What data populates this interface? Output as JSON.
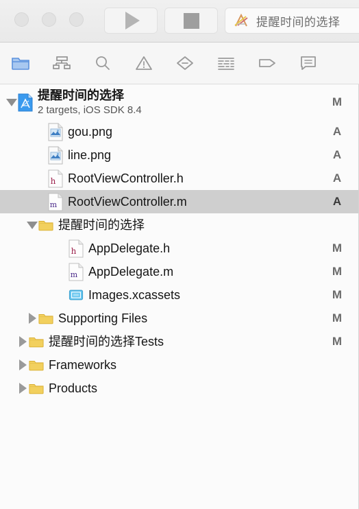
{
  "window": {
    "traffic_lights": [
      "close",
      "minimize",
      "zoom"
    ]
  },
  "toolbar": {
    "run_label": "Run",
    "stop_label": "Stop",
    "scheme_name": "提醒时间的选择"
  },
  "navigator_tabs": [
    {
      "name": "project-navigator",
      "icon": "folder-icon",
      "active": true
    },
    {
      "name": "symbol-navigator",
      "icon": "hierarchy-icon",
      "active": false
    },
    {
      "name": "find-navigator",
      "icon": "search-icon",
      "active": false
    },
    {
      "name": "issue-navigator",
      "icon": "warning-triangle-icon",
      "active": false
    },
    {
      "name": "test-navigator",
      "icon": "diamond-icon",
      "active": false
    },
    {
      "name": "debug-navigator",
      "icon": "debug-lines-icon",
      "active": false
    },
    {
      "name": "breakpoint-navigator",
      "icon": "breakpoint-tag-icon",
      "active": false
    },
    {
      "name": "report-navigator",
      "icon": "comment-bubble-icon",
      "active": false
    }
  ],
  "tree": {
    "rows": [
      {
        "label": "提醒时间的选择",
        "subtitle": "2 targets, iOS SDK 8.4",
        "badge": "M",
        "icon": "xcode-project-icon",
        "disclosure": "down",
        "indent": 0,
        "selected": false,
        "bold": true
      },
      {
        "label": "gou.png",
        "subtitle": "",
        "badge": "A",
        "icon": "png-image-icon",
        "disclosure": "none",
        "indent": 1,
        "selected": false,
        "bold": false
      },
      {
        "label": "line.png",
        "subtitle": "",
        "badge": "A",
        "icon": "png-image-icon",
        "disclosure": "none",
        "indent": 1,
        "selected": false,
        "bold": false
      },
      {
        "label": "RootViewController.h",
        "subtitle": "",
        "badge": "A",
        "icon": "header-file-icon",
        "disclosure": "none",
        "indent": 1,
        "selected": false,
        "bold": false
      },
      {
        "label": "RootViewController.m",
        "subtitle": "",
        "badge": "A",
        "icon": "implementation-file-icon",
        "disclosure": "none",
        "indent": 1,
        "selected": true,
        "bold": false
      },
      {
        "label": "提醒时间的选择",
        "subtitle": "",
        "badge": "",
        "icon": "yellow-folder-icon",
        "disclosure": "down",
        "indent": 2,
        "selected": false,
        "bold": false
      },
      {
        "label": "AppDelegate.h",
        "subtitle": "",
        "badge": "M",
        "icon": "header-file-icon",
        "disclosure": "none",
        "indent": 3,
        "selected": false,
        "bold": false
      },
      {
        "label": "AppDelegate.m",
        "subtitle": "",
        "badge": "M",
        "icon": "implementation-file-icon",
        "disclosure": "none",
        "indent": 3,
        "selected": false,
        "bold": false
      },
      {
        "label": "Images.xcassets",
        "subtitle": "",
        "badge": "M",
        "icon": "xcassets-icon",
        "disclosure": "none",
        "indent": 3,
        "selected": false,
        "bold": false
      },
      {
        "label": "Supporting Files",
        "subtitle": "",
        "badge": "M",
        "icon": "yellow-folder-icon",
        "disclosure": "right",
        "indent": 2,
        "selected": false,
        "bold": false
      },
      {
        "label": "提醒时间的选择Tests",
        "subtitle": "",
        "badge": "M",
        "icon": "yellow-folder-icon",
        "disclosure": "right",
        "indent": 4,
        "selected": false,
        "bold": false
      },
      {
        "label": "Frameworks",
        "subtitle": "",
        "badge": "",
        "icon": "yellow-folder-icon",
        "disclosure": "right",
        "indent": 4,
        "selected": false,
        "bold": false
      },
      {
        "label": "Products",
        "subtitle": "",
        "badge": "",
        "icon": "yellow-folder-icon",
        "disclosure": "right",
        "indent": 4,
        "selected": false,
        "bold": false
      }
    ]
  },
  "colors": {
    "selection": "#cfcfcf",
    "accent_blue": "#6f9fe8",
    "folder_yellow": "#f0cf60",
    "badge_gray": "#6b6b6b"
  }
}
